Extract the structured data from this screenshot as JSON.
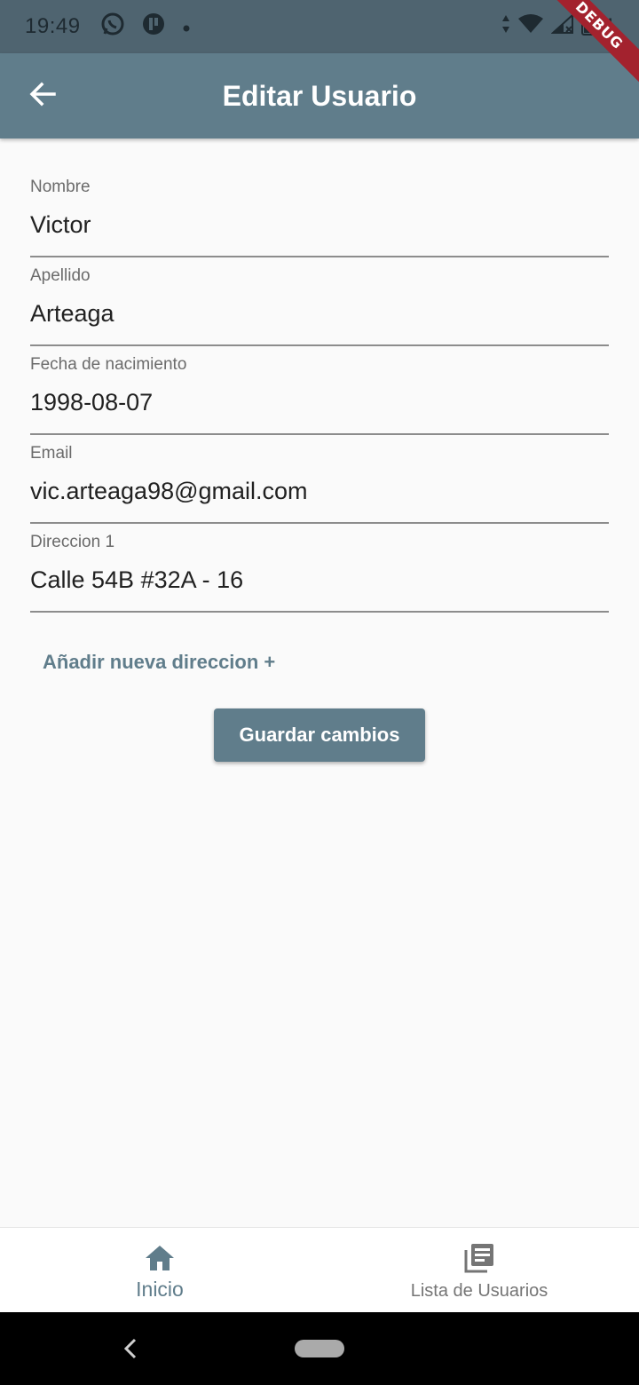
{
  "status_bar": {
    "time": "19:49",
    "battery": "4",
    "icons_left": [
      "whatsapp-icon",
      "app-icon",
      "dot-icon"
    ],
    "icons_right": [
      "data-arrows-icon",
      "wifi-icon",
      "signal-icon",
      "battery-icon"
    ]
  },
  "debug_banner": "DEBUG",
  "app_bar": {
    "title": "Editar Usuario",
    "back_icon": "arrow-back-icon"
  },
  "form": {
    "fields": [
      {
        "label": "Nombre",
        "value": "Victor"
      },
      {
        "label": "Apellido",
        "value": "Arteaga"
      },
      {
        "label": "Fecha de nacimiento",
        "value": "1998-08-07"
      },
      {
        "label": "Email",
        "value": "vic.arteaga98@gmail.com"
      },
      {
        "label": "Direccion 1",
        "value": "Calle 54B #32A - 16"
      }
    ],
    "add_address_label": "Añadir nueva direccion +",
    "save_label": "Guardar cambios"
  },
  "bottom_nav": {
    "items": [
      {
        "label": "Inicio",
        "icon": "home-icon",
        "active": true
      },
      {
        "label": "Lista de Usuarios",
        "icon": "library-books-icon",
        "active": false
      }
    ]
  },
  "colors": {
    "primary": "#607d8b",
    "status_bar": "#4f6470",
    "background": "#fafafa",
    "debug_ribbon": "#a3222e"
  }
}
